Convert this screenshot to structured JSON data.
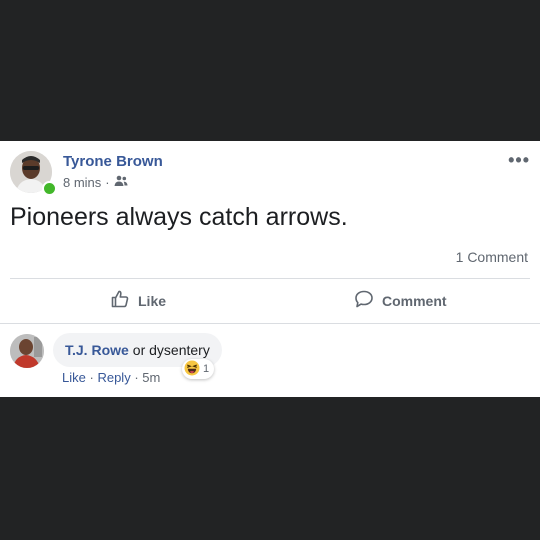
{
  "post": {
    "author": "Tyrone Brown",
    "time": "8 mins",
    "separator": "·",
    "audience_icon": "friends-icon",
    "more_icon": "•••",
    "text": "Pioneers always catch arrows.",
    "comment_count": "1 Comment",
    "actions": {
      "like": "Like",
      "comment": "Comment"
    }
  },
  "comment": {
    "author": "T.J. Rowe",
    "text": "or dysentery",
    "actions": {
      "like": "Like",
      "reply": "Reply",
      "time": "5m",
      "sep": "·"
    },
    "reaction_count": "1",
    "reaction_icon": "haha-emoji-icon"
  },
  "colors": {
    "link_blue": "#385898",
    "meta_gray": "#606770",
    "online_green": "#42b72a",
    "background_dark": "#222324"
  }
}
